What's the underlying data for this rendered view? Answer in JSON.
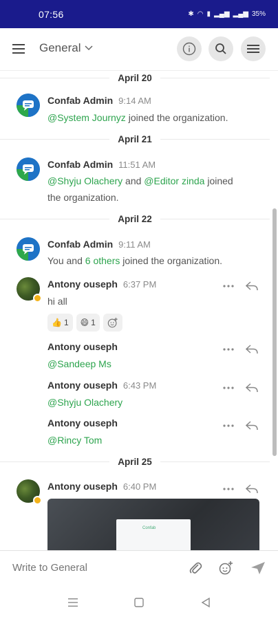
{
  "status_bar": {
    "time": "07:56",
    "battery": "35%"
  },
  "header": {
    "channel": "General"
  },
  "colors": {
    "status_bar": "#1a1b8c",
    "mention": "#2da44e",
    "bot_avatar": "#1e73c6"
  },
  "messages": [
    {
      "date": "April 20",
      "sender": "Confab Admin",
      "time": "9:14 AM",
      "mention": "@System Journyz",
      "text": "joined the organization."
    },
    {
      "date": "April 21",
      "sender": "Confab Admin",
      "time": "11:51 AM",
      "mention1": "@Shyju Olachery",
      "and": "and",
      "mention2": "@Editor zinda",
      "text_line1": "joined",
      "text_line2": "the organization."
    },
    {
      "date": "April 22",
      "sender": "Confab Admin",
      "time": "9:11 AM",
      "prefix": "You and",
      "others": "6 others",
      "text": "joined the organization."
    },
    {
      "sender": "Antony ouseph",
      "time": "6:37 PM",
      "text": "hi all",
      "reactions": [
        {
          "emoji": "👍",
          "count": "1"
        },
        {
          "emoji": "😄",
          "count": "1"
        }
      ]
    },
    {
      "sender": "Antony ouseph",
      "mention": "@Sandeep Ms"
    },
    {
      "sender": "Antony ouseph",
      "time": "6:43 PM",
      "mention": "@Shyju Olachery"
    },
    {
      "sender": "Antony ouseph",
      "mention": "@Rincy Tom"
    },
    {
      "date": "April 25",
      "sender": "Antony ouseph",
      "time": "6:40 PM"
    }
  ],
  "composer": {
    "placeholder": "Write to General"
  },
  "image_preview": {
    "logo_text": "Confab"
  },
  "icons": [
    "menu-icon",
    "chevron-down-icon",
    "info-icon",
    "search-icon",
    "more-menu-icon",
    "more-horizontal-icon",
    "reply-icon",
    "add-reaction-icon",
    "attach-icon",
    "emoji-icon",
    "send-icon",
    "recents-icon",
    "home-icon",
    "back-icon"
  ]
}
